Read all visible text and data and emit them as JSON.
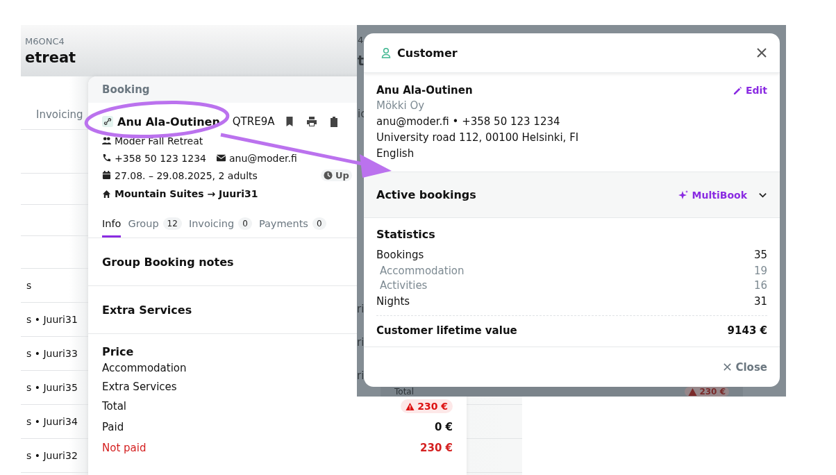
{
  "background_page": {
    "code": "M6ONC4",
    "title": "etreat",
    "tab": "Invoicing",
    "rows": [
      "s",
      "s • Juuri31",
      "s • Juuri33",
      "s • Juuri35",
      "s • Juuri34",
      "s • Juuri32"
    ]
  },
  "booking_panel": {
    "title": "Booking",
    "customer_name": "Anu Ala-Outinen",
    "booking_code": "QTRE9A",
    "group_name": "Moder Fall Retreat",
    "phone": "+358 50 123 1234",
    "email": "anu@moder.fi",
    "dates": "27.08. – 29.08.2025, 2 adults",
    "status_badge": "Up",
    "room": "Mountain Suites → Juuri31",
    "tabs": [
      {
        "label": "Info",
        "selected": true
      },
      {
        "label": "Group",
        "count": "12",
        "selected": false
      },
      {
        "label": "Invoicing",
        "count": "0",
        "selected": false
      },
      {
        "label": "Payments",
        "count": "0",
        "selected": false
      }
    ],
    "sections": [
      "Group Booking notes",
      "Extra Services"
    ],
    "price": {
      "title": "Price",
      "rows": [
        {
          "label": "Accommodation",
          "kind": "plain"
        },
        {
          "label": "Extra Services",
          "kind": "plain"
        },
        {
          "label": "Total",
          "value": "230 €",
          "kind": "alert"
        },
        {
          "label": "Paid",
          "value": "0 €",
          "kind": "plain"
        },
        {
          "label": "Not paid",
          "value": "230 €",
          "kind": "unpaid"
        }
      ]
    }
  },
  "dimmed_page": {
    "fragments": [
      "4",
      "t",
      "ic",
      "ri",
      "ri",
      "ri"
    ],
    "total_label": "Total",
    "total_value": "230 €"
  },
  "customer_dialog": {
    "title": "Customer",
    "name": "Anu Ala-Outinen",
    "edit": "Edit",
    "company": "Mökki Oy",
    "contact": "anu@moder.fi • +358 50 123 1234",
    "address": "University road 112, 00100 Helsinki, FI",
    "language": "English",
    "active_bookings": {
      "title": "Active bookings",
      "action": "MultiBook",
      "expanded": false
    },
    "statistics": {
      "title": "Statistics",
      "rows": [
        {
          "label": "Bookings",
          "value": "35",
          "kind": "main"
        },
        {
          "label": "Accommodation",
          "value": "19",
          "kind": "sub"
        },
        {
          "label": "Activities",
          "value": "16",
          "kind": "sub"
        },
        {
          "label": "Nights",
          "value": "31",
          "kind": "main"
        }
      ],
      "total": {
        "label": "Customer lifetime value",
        "value": "9143 €"
      }
    },
    "close": "Close"
  }
}
